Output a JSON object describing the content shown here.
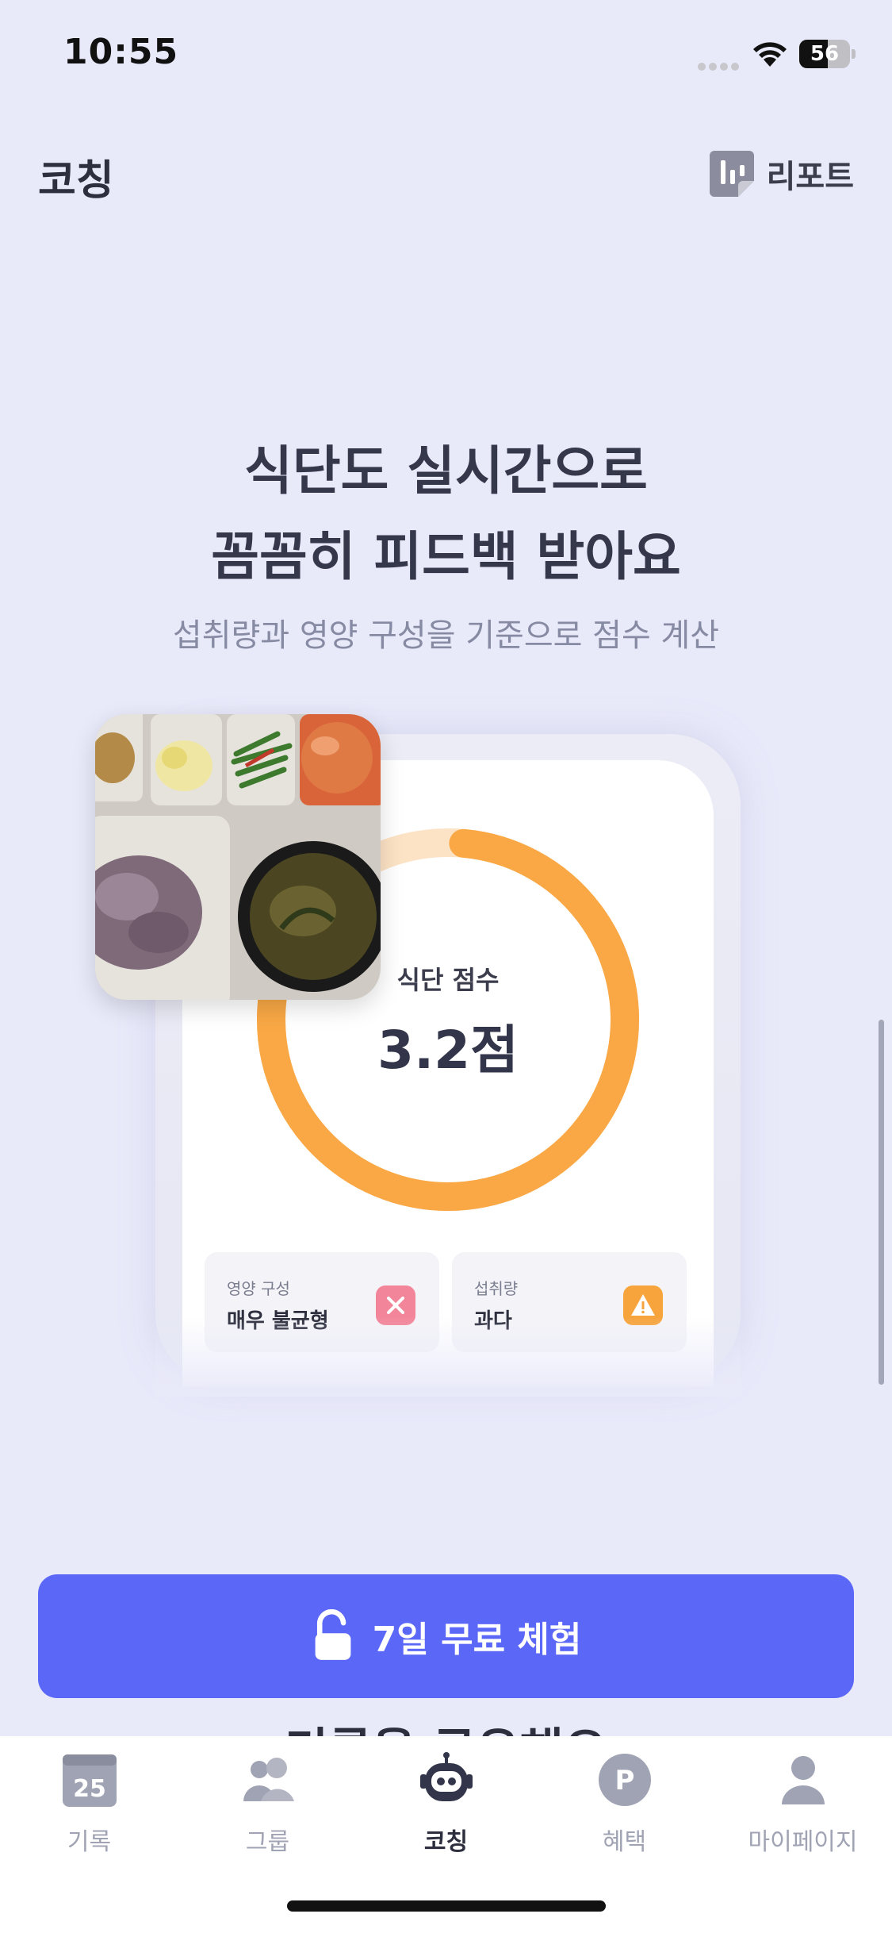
{
  "status_bar": {
    "time": "10:55",
    "battery": "56",
    "battery_level": 0.56
  },
  "header": {
    "title": "코칭",
    "report_label": "리포트"
  },
  "hero": {
    "title_line1": "식단도 실시간으로",
    "title_line2": "꼼꼼히 피드백 받아요",
    "subtitle": "섭취량과 영양 구성을 기준으로 점수 계산"
  },
  "mock": {
    "score_label": "식단 점수",
    "score_value": "3.2점",
    "score_fraction": 0.8,
    "chips": [
      {
        "caption": "영양 구성",
        "value": "매우 불균형",
        "icon": "x-icon"
      },
      {
        "caption": "섭취량",
        "value": "과다",
        "icon": "warning-icon"
      }
    ]
  },
  "cta": {
    "label": "7일 무료 체험",
    "icon": "unlock-icon"
  },
  "peek_text": "기록을 공유해요",
  "tabs": [
    {
      "label": "기록",
      "icon": "calendar-icon",
      "badge": "25"
    },
    {
      "label": "그룹",
      "icon": "group-icon"
    },
    {
      "label": "코칭",
      "icon": "robot-icon",
      "active": true
    },
    {
      "label": "혜택",
      "icon": "points-icon",
      "badge": "P"
    },
    {
      "label": "마이페이지",
      "icon": "person-icon"
    }
  ],
  "colors": {
    "accent": "#5b67f7",
    "ring": "#f9a845",
    "ring_track": "#fde3c5",
    "background": "#e8e9f9"
  }
}
